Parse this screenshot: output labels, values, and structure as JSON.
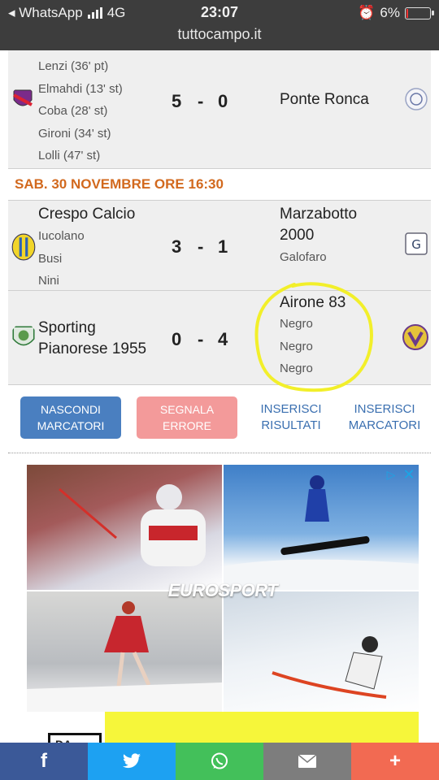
{
  "status_bar": {
    "back_app": "◂ WhatsApp",
    "network": "4G",
    "time": "23:07",
    "battery": "6%",
    "url": "tuttocampo.it"
  },
  "matches": [
    {
      "home_scorers": [
        "Lenzi (36' pt)",
        "Elmahdi (13' st)",
        "Coba (28' st)",
        "Gironi (34' st)",
        "Lolli (47' st)"
      ],
      "score_home": "5",
      "score_sep": "-",
      "score_away": "0",
      "away_team": "Ponte Ronca"
    },
    {
      "home_team": "Crespo Calcio",
      "home_scorers": [
        "Iucolano",
        "Busi",
        "Nini"
      ],
      "score_home": "3",
      "score_sep": "-",
      "score_away": "1",
      "away_team_line1": "Marzabotto",
      "away_team_line2": "2000",
      "away_scorers": [
        "Galofaro"
      ]
    },
    {
      "home_team_line1": "Sporting",
      "home_team_line2": "Pianorese 1955",
      "score_home": "0",
      "score_sep": "-",
      "score_away": "4",
      "away_team": "Airone 83",
      "away_scorers": [
        "Negro",
        "Negro",
        "Negro"
      ]
    }
  ],
  "date_header": "SAB. 30 NOVEMBRE ORE 16:30",
  "buttons": {
    "hide_scorers": "NASCONDI MARCATORI",
    "report_error": "SEGNALA ERRORE",
    "insert_results": "INSERISCI RISULTATI",
    "insert_scorers": "INSERISCI MARCATORI"
  },
  "ad": {
    "brand": "EUROSPORT"
  },
  "share_bar": {
    "facebook": "f",
    "twitter": "twitter-icon",
    "whatsapp": "whatsapp-icon",
    "email": "email-icon",
    "more": "+"
  },
  "colors": {
    "date_header": "#d2691e",
    "button_blue": "#4a7fc0",
    "button_red": "#f39a9a",
    "link": "#3a6fb0",
    "highlight": "#f2ef2a"
  }
}
